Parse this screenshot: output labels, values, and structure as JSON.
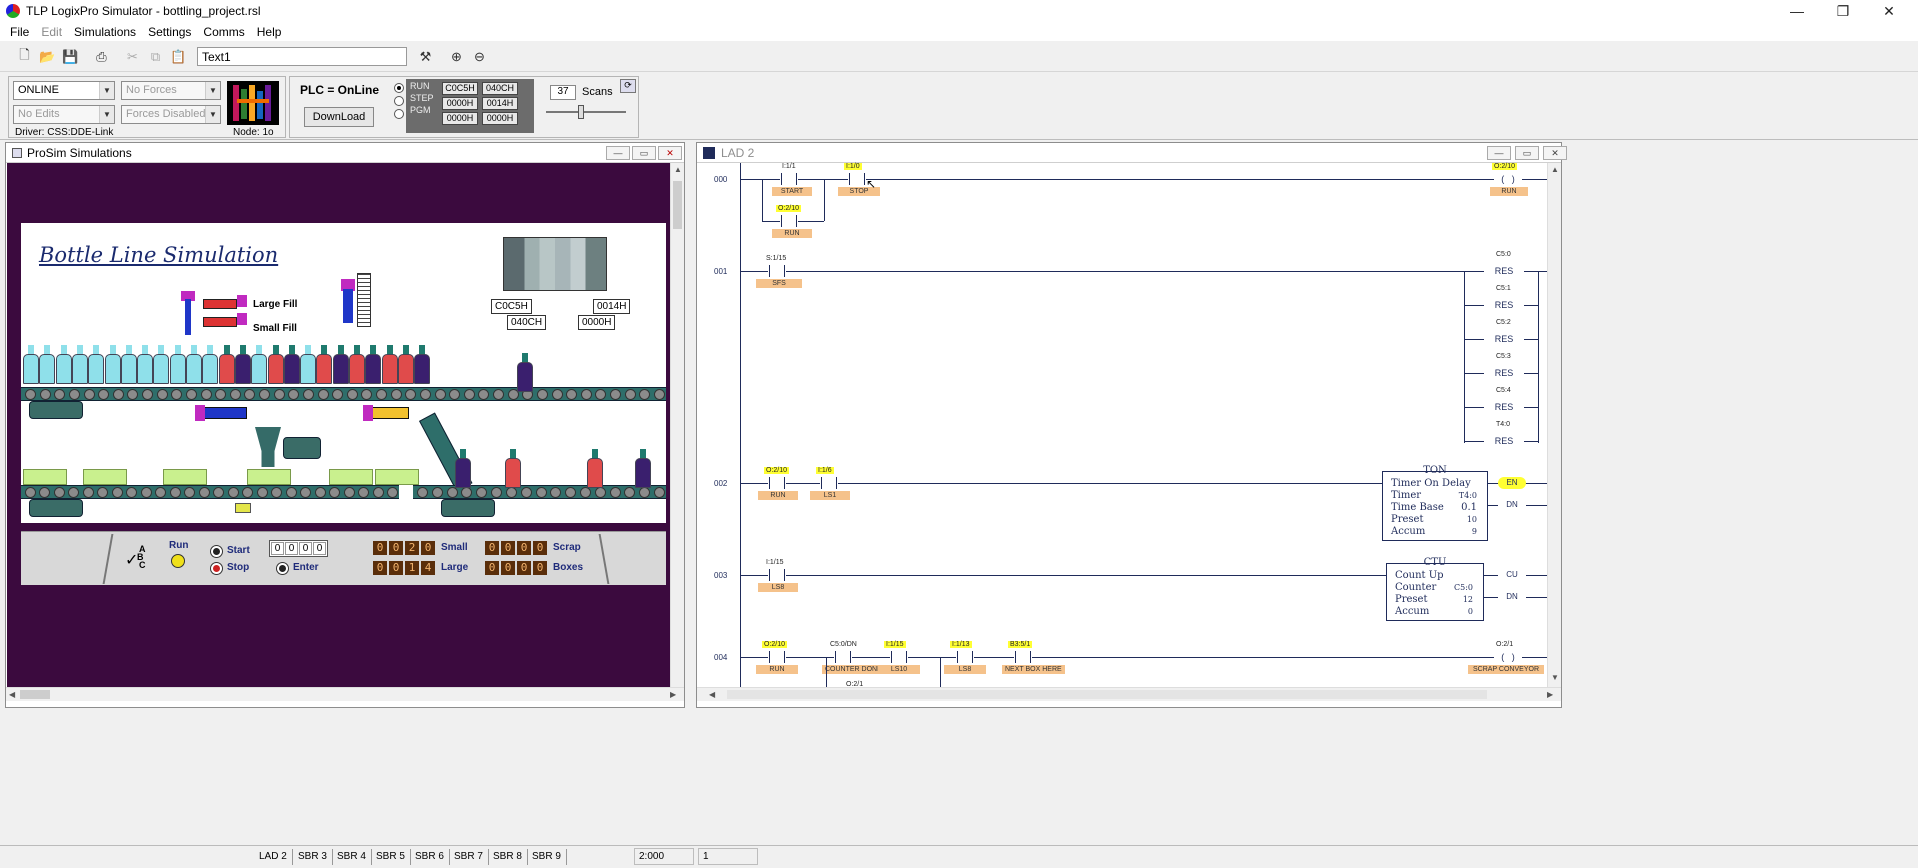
{
  "window": {
    "title": "TLP LogixPro Simulator  -  bottling_project.rsl",
    "minimize": "—",
    "maximize": "❐",
    "close": "✕"
  },
  "menu": {
    "items": [
      "File",
      "Edit",
      "Simulations",
      "Settings",
      "Comms",
      "Help"
    ]
  },
  "toolbar": {
    "textbox_value": "Text1"
  },
  "status": {
    "mode": "ONLINE",
    "forces": "No Forces",
    "edits": "No Edits",
    "forces_state": "Forces Disabled",
    "driver": "Driver: CSS:DDE-Link",
    "node": "Node: 1o",
    "plc_state": "PLC = OnLine",
    "download_label": "DownLoad",
    "modes": [
      "RUN",
      "STEP",
      "PGM"
    ],
    "hex_top": [
      "C0C5H",
      "040CH"
    ],
    "hex_mid": [
      "0000H",
      "0014H"
    ],
    "hex_bot": [
      "0000H",
      "0000H"
    ],
    "scans": "37",
    "scans_label": "Scans"
  },
  "prosim": {
    "title": "ProSim Simulations",
    "heading": "Bottle Line Simulation",
    "large_fill": "Large Fill",
    "small_fill": "Small Fill",
    "plc_values": [
      "C0C5H",
      "0014H",
      "040CH",
      "0000H"
    ],
    "panel": {
      "abc": [
        "A",
        "B",
        "C"
      ],
      "run": "Run",
      "start": "Start",
      "stop": "Stop",
      "enter": "Enter",
      "thumbwheel": [
        "0",
        "0",
        "0",
        "0"
      ],
      "small_label": "Small",
      "small_digits": [
        "0",
        "0",
        "2",
        "0"
      ],
      "large_label": "Large",
      "large_digits": [
        "0",
        "0",
        "1",
        "4"
      ],
      "scrap_label": "Scrap",
      "scrap_digits": [
        "0",
        "0",
        "0",
        "0"
      ],
      "boxes_label": "Boxes",
      "boxes_digits": [
        "0",
        "0",
        "0",
        "0"
      ]
    }
  },
  "ladder": {
    "title": "LAD 2",
    "rungs": [
      {
        "num": "000",
        "start_addr": "I:1/1",
        "start_tag": "START",
        "stop_addr": "I:1/0",
        "stop_tag": "STOP",
        "seal_addr": "O:2/10",
        "seal_tag": "RUN",
        "coil_addr": "O:2/10",
        "coil_tag": "RUN"
      },
      {
        "num": "001",
        "contact_addr": "S:1/15",
        "contact_tag": "SFS",
        "coils": [
          {
            "addr": "C5:0",
            "label": "RES"
          },
          {
            "addr": "C5:1",
            "label": "RES"
          },
          {
            "addr": "C5:2",
            "label": "RES"
          },
          {
            "addr": "C5:3",
            "label": "RES"
          },
          {
            "addr": "C5:4",
            "label": "RES"
          },
          {
            "addr": "T4:0",
            "label": "RES"
          }
        ]
      },
      {
        "num": "002",
        "c1_addr": "O:2/10",
        "c1_tag": "RUN",
        "c2_addr": "I:1/6",
        "c2_tag": "LS1",
        "block_title": "TON",
        "rows": [
          "Timer On Delay",
          "Timer",
          "Time Base",
          "Preset",
          "Accum"
        ],
        "values": [
          "T4:0",
          "0.1",
          "10",
          "9"
        ],
        "outputs": [
          "EN",
          "DN"
        ]
      },
      {
        "num": "003",
        "c1_addr": "I:1/15",
        "c1_tag": "LS8",
        "block_title": "CTU",
        "rows": [
          "Count Up",
          "Counter",
          "Preset",
          "Accum"
        ],
        "values": [
          "C5:0",
          "12",
          "0"
        ],
        "outputs": [
          "CU",
          "DN"
        ]
      },
      {
        "num": "004",
        "contacts": [
          {
            "addr": "O:2/10",
            "tag": "RUN"
          },
          {
            "addr": "C5:0/DN",
            "tag": "COUNTER DONE"
          },
          {
            "addr": "I:1/15",
            "tag": "LS10"
          },
          {
            "addr": "I:1/13",
            "tag": "LS8"
          },
          {
            "addr": "B3:5/1",
            "tag": "NEXT BOX HERE"
          }
        ],
        "branch_addr": "O:2/1",
        "coil_addr": "O:2/1",
        "coil_tag": "SCRAP CONVEYOR"
      }
    ]
  },
  "bottom": {
    "tabs": [
      "LAD 2",
      "SBR 3",
      "SBR 4",
      "SBR 5",
      "SBR 6",
      "SBR 7",
      "SBR 8",
      "SBR 9"
    ],
    "position": "2:000",
    "field2": "1"
  }
}
